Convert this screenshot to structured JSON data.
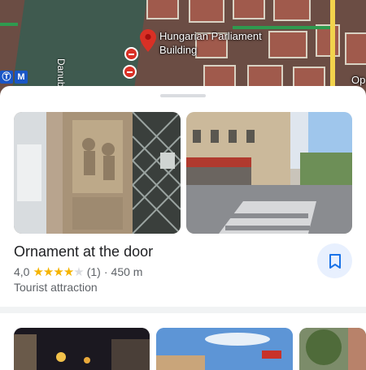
{
  "map": {
    "landmark_label": "Hungarian Parliament Building",
    "river_label": "Danube",
    "metro_badges": [
      "Ⓣ",
      "M"
    ],
    "corner_label": "Op",
    "icons": [
      "place-pin-icon",
      "bus-stop-icon",
      "metro-icon"
    ]
  },
  "place": {
    "title": "Ornament at the door",
    "rating": "4,0",
    "rating_value": 4.0,
    "stars_max": 5,
    "reviews": "(1)",
    "separator": "·",
    "distance": "450 m",
    "category": "Tourist attraction",
    "save_icon": "bookmark-icon"
  },
  "colors": {
    "accent": "#1a73e8",
    "pin": "#d93025",
    "star": "#f5b400",
    "save_bg": "#e8f0fe"
  }
}
